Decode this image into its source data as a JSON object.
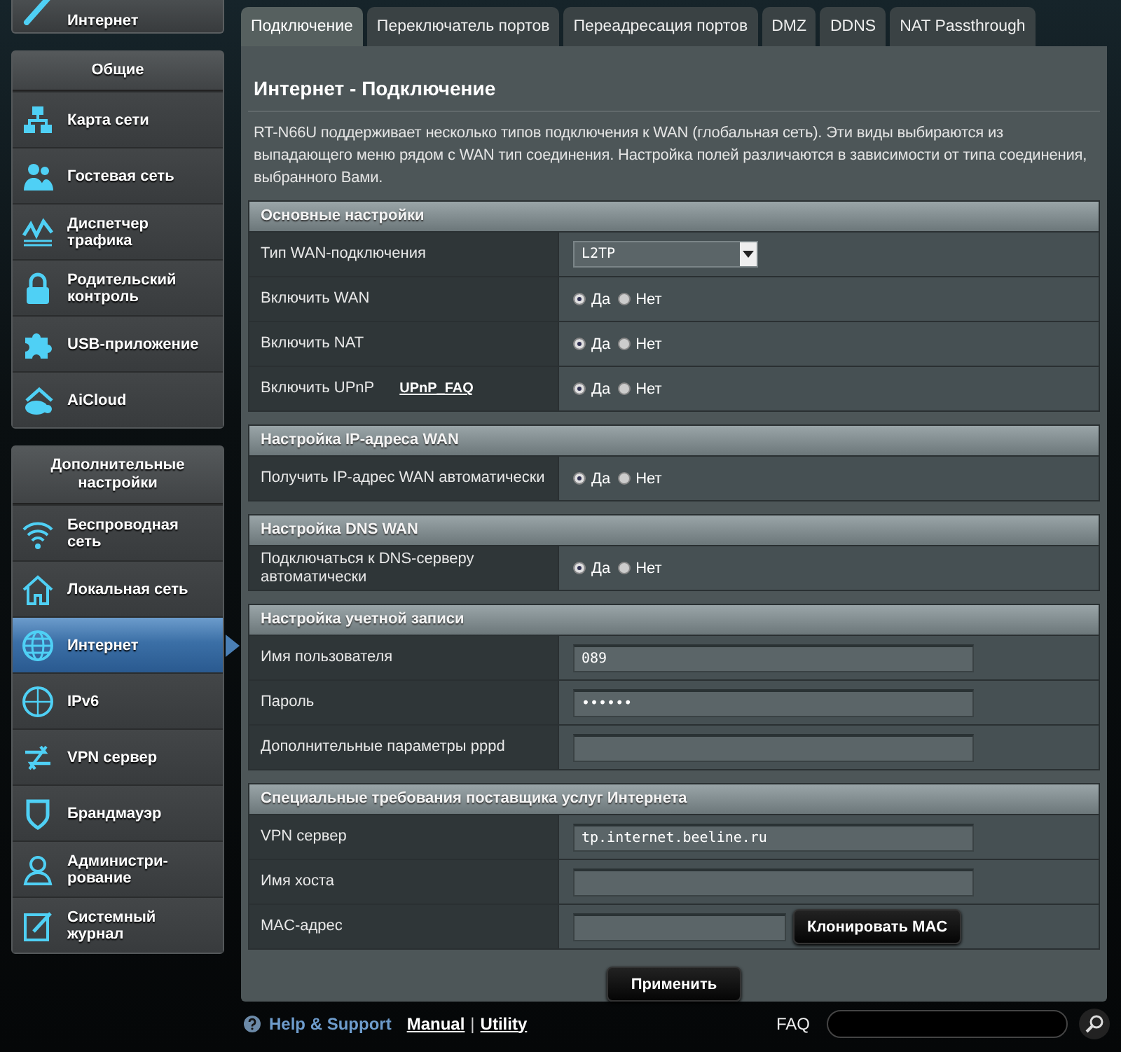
{
  "sidebar": {
    "top_item": {
      "label": "Интернет"
    },
    "groups": [
      {
        "title": "Общие",
        "items": [
          {
            "label": "Карта сети",
            "selected": false
          },
          {
            "label": "Гостевая сеть",
            "selected": false
          },
          {
            "label": "Диспетчер трафика",
            "selected": false
          },
          {
            "label": "Родительский контроль",
            "selected": false
          },
          {
            "label": "USB-приложение",
            "selected": false
          },
          {
            "label": "AiCloud",
            "selected": false
          }
        ]
      },
      {
        "title": "Дополнительные настройки",
        "items": [
          {
            "label": "Беспроводная сеть",
            "selected": false
          },
          {
            "label": "Локальная сеть",
            "selected": false
          },
          {
            "label": "Интернет",
            "selected": true
          },
          {
            "label": "IPv6",
            "selected": false
          },
          {
            "label": "VPN сервер",
            "selected": false
          },
          {
            "label": "Брандмауэр",
            "selected": false
          },
          {
            "label": "Администри-рование",
            "selected": false
          },
          {
            "label": "Системный журнал",
            "selected": false
          }
        ]
      }
    ]
  },
  "tabs": [
    {
      "label": "Подключение",
      "selected": true
    },
    {
      "label": "Переключатель портов",
      "selected": false
    },
    {
      "label": "Переадресация портов",
      "selected": false
    },
    {
      "label": "DMZ",
      "selected": false
    },
    {
      "label": "DDNS",
      "selected": false
    },
    {
      "label": "NAT Passthrough",
      "selected": false
    }
  ],
  "panel": {
    "title": "Интернет - Подключение",
    "description": "RT-N66U поддерживает несколько типов подключения к WAN (глобальная сеть). Эти виды выбираются из выпадающего меню рядом с WAN тип соединения. Настройка полей различаются в зависимости от типа соединения, выбранного Вами.",
    "sections": [
      {
        "title": "Основные настройки",
        "rows": [
          {
            "label": "Тип WAN-подключения",
            "kind": "select",
            "value": "L2TP"
          },
          {
            "label": "Включить WAN",
            "kind": "radio",
            "options": [
              {
                "label": "Да",
                "selected": true
              },
              {
                "label": "Нет",
                "selected": false
              }
            ]
          },
          {
            "label": "Включить NAT",
            "kind": "radio",
            "options": [
              {
                "label": "Да",
                "selected": true
              },
              {
                "label": "Нет",
                "selected": false
              }
            ]
          },
          {
            "label": "Включить UPnP",
            "link": "UPnP_FAQ",
            "kind": "radio",
            "options": [
              {
                "label": "Да",
                "selected": true
              },
              {
                "label": "Нет",
                "selected": false
              }
            ]
          }
        ]
      },
      {
        "title": "Настройка IP-адреса WAN",
        "rows": [
          {
            "label": "Получить IP-адрес WAN автоматически",
            "kind": "radio",
            "options": [
              {
                "label": "Да",
                "selected": true
              },
              {
                "label": "Нет",
                "selected": false
              }
            ]
          }
        ]
      },
      {
        "title": "Настройка DNS WAN",
        "rows": [
          {
            "label": "Подключаться к DNS-серверу автоматически",
            "kind": "radio",
            "options": [
              {
                "label": "Да",
                "selected": true
              },
              {
                "label": "Нет",
                "selected": false
              }
            ]
          }
        ]
      },
      {
        "title": "Настройка учетной записи",
        "rows": [
          {
            "label": "Имя пользователя",
            "kind": "text",
            "value": "089"
          },
          {
            "label": "Пароль",
            "kind": "text",
            "value": "••••••"
          },
          {
            "label": "Дополнительные параметры pppd",
            "kind": "text"
          }
        ]
      },
      {
        "title": "Специальные требования поставщика услуг Интернета",
        "rows": [
          {
            "label": "VPN сервер",
            "kind": "text",
            "value": "tp.internet.beeline.ru"
          },
          {
            "label": "Имя хоста",
            "kind": "text"
          },
          {
            "label": "MAC-адрес",
            "kind": "text_button",
            "button": "Клонировать MAC"
          }
        ]
      }
    ],
    "apply_button": "Применить"
  },
  "footer": {
    "help": "Help & Support",
    "manual": "Manual",
    "separator": "|",
    "utility": "Utility",
    "faq": "FAQ"
  }
}
